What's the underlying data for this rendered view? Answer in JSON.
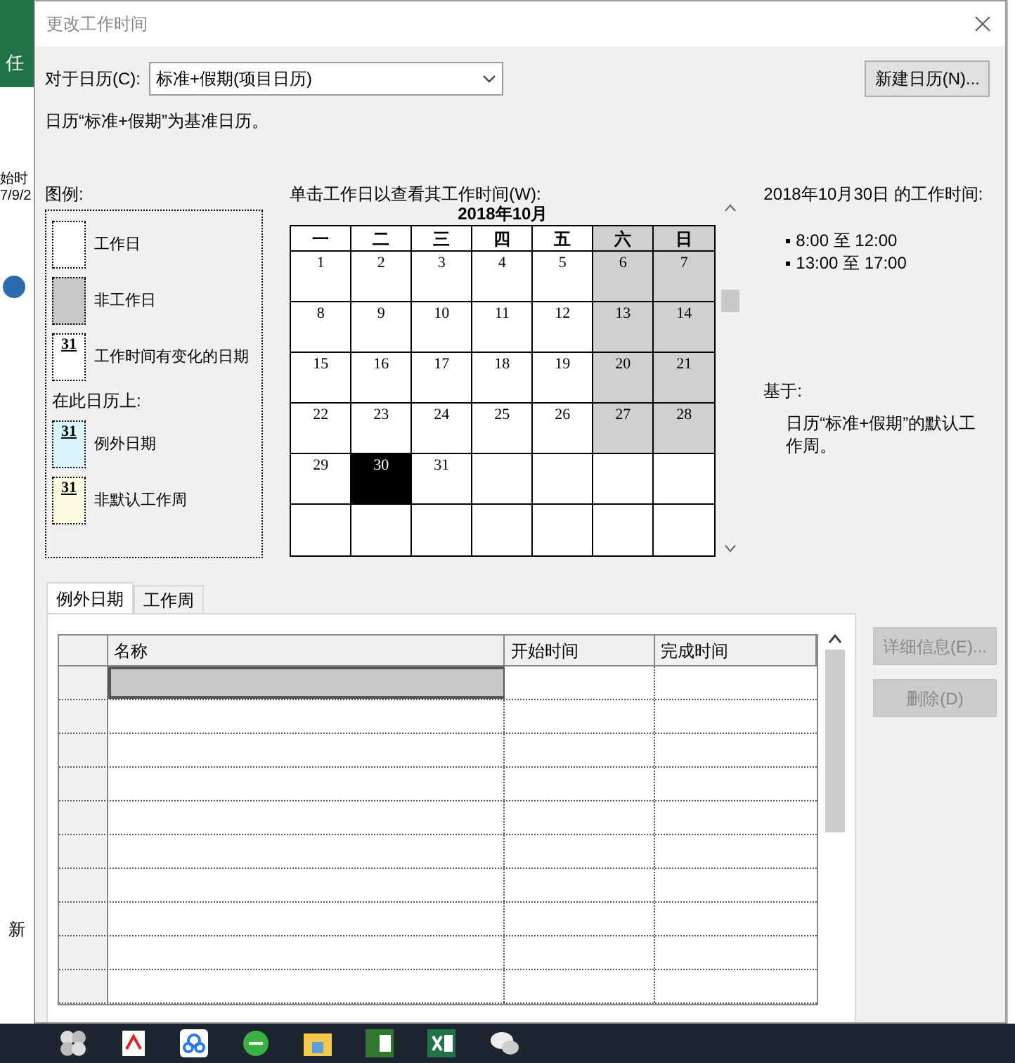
{
  "background_app": {
    "ribbon_text": "任",
    "column_header": "始时",
    "date_text": "7/9/2",
    "bottom_text": "新"
  },
  "window": {
    "title": "更改工作时间"
  },
  "calendar_field": {
    "label": "对于日历(C):",
    "value": "标准+假期(项目日历)"
  },
  "new_calendar_button": "新建日历(N)...",
  "base_note": "日历“标准+假期”为基准日历。",
  "legend": {
    "title": "图例:",
    "items": [
      {
        "kind": "working",
        "label": "工作日"
      },
      {
        "kind": "nonworking",
        "label": "非工作日"
      },
      {
        "kind": "changed",
        "label": "工作时间有变化的日期",
        "mark": "31"
      }
    ],
    "subtitle": "在此日历上:",
    "calendar_items": [
      {
        "kind": "exception",
        "label": "例外日期",
        "mark": "31"
      },
      {
        "kind": "nondefault",
        "label": "非默认工作周",
        "mark": "31"
      }
    ]
  },
  "calendar": {
    "instruction": "单击工作日以查看其工作时间(W):",
    "month": "2018年10月",
    "weekdays": [
      "一",
      "二",
      "三",
      "四",
      "五",
      "六",
      "日"
    ],
    "weeks": [
      [
        {
          "day": "1",
          "nonworking": false,
          "selected": false
        },
        {
          "day": "2",
          "nonworking": false,
          "selected": false
        },
        {
          "day": "3",
          "nonworking": false,
          "selected": false
        },
        {
          "day": "4",
          "nonworking": false,
          "selected": false
        },
        {
          "day": "5",
          "nonworking": false,
          "selected": false
        },
        {
          "day": "6",
          "nonworking": true,
          "selected": false
        },
        {
          "day": "7",
          "nonworking": true,
          "selected": false
        }
      ],
      [
        {
          "day": "8",
          "nonworking": false,
          "selected": false
        },
        {
          "day": "9",
          "nonworking": false,
          "selected": false
        },
        {
          "day": "10",
          "nonworking": false,
          "selected": false
        },
        {
          "day": "11",
          "nonworking": false,
          "selected": false
        },
        {
          "day": "12",
          "nonworking": false,
          "selected": false
        },
        {
          "day": "13",
          "nonworking": true,
          "selected": false
        },
        {
          "day": "14",
          "nonworking": true,
          "selected": false
        }
      ],
      [
        {
          "day": "15",
          "nonworking": false,
          "selected": false
        },
        {
          "day": "16",
          "nonworking": false,
          "selected": false
        },
        {
          "day": "17",
          "nonworking": false,
          "selected": false
        },
        {
          "day": "18",
          "nonworking": false,
          "selected": false
        },
        {
          "day": "19",
          "nonworking": false,
          "selected": false
        },
        {
          "day": "20",
          "nonworking": true,
          "selected": false
        },
        {
          "day": "21",
          "nonworking": true,
          "selected": false
        }
      ],
      [
        {
          "day": "22",
          "nonworking": false,
          "selected": false
        },
        {
          "day": "23",
          "nonworking": false,
          "selected": false
        },
        {
          "day": "24",
          "nonworking": false,
          "selected": false
        },
        {
          "day": "25",
          "nonworking": false,
          "selected": false
        },
        {
          "day": "26",
          "nonworking": false,
          "selected": false
        },
        {
          "day": "27",
          "nonworking": true,
          "selected": false
        },
        {
          "day": "28",
          "nonworking": true,
          "selected": false
        }
      ],
      [
        {
          "day": "29",
          "nonworking": false,
          "selected": false
        },
        {
          "day": "30",
          "nonworking": false,
          "selected": true
        },
        {
          "day": "31",
          "nonworking": false,
          "selected": false
        }
      ]
    ]
  },
  "working_times": {
    "title": "2018年10月30日 的工作时间:",
    "items": [
      "8:00 至 12:00",
      "13:00 至 17:00"
    ],
    "based_on_label": "基于:",
    "based_on_text": "日历“标准+假期”的默认工作周。"
  },
  "tabs": [
    {
      "label": "例外日期",
      "selected": true
    },
    {
      "label": "工作周",
      "selected": false
    }
  ],
  "table": {
    "columns": [
      "名称",
      "开始时间",
      "完成时间"
    ],
    "rows": [
      {
        "selected": true
      },
      {
        "selected": false
      },
      {
        "selected": false
      },
      {
        "selected": false
      },
      {
        "selected": false
      },
      {
        "selected": false
      },
      {
        "selected": false
      },
      {
        "selected": false
      },
      {
        "selected": false
      },
      {
        "selected": false
      }
    ]
  },
  "side_buttons": [
    {
      "label": "详细信息(E)...",
      "disabled": true
    },
    {
      "label": "删除(D)",
      "disabled": true
    }
  ]
}
